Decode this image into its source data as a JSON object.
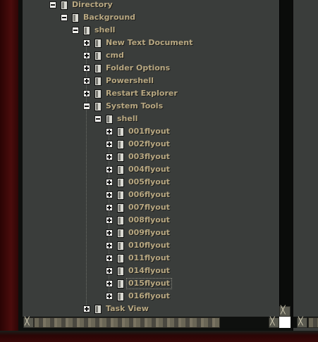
{
  "tree": [
    {
      "label": "Directory",
      "toggle": "minus",
      "level": 0
    },
    {
      "label": "Background",
      "toggle": "minus",
      "level": 1
    },
    {
      "label": "shell",
      "toggle": "minus",
      "level": 2
    },
    {
      "label": "New Text Document",
      "toggle": "plus",
      "level": 3
    },
    {
      "label": "cmd",
      "toggle": "plus",
      "level": 3
    },
    {
      "label": "Folder Options",
      "toggle": "plus",
      "level": 3
    },
    {
      "label": "Powershell",
      "toggle": "plus",
      "level": 3
    },
    {
      "label": "Restart Explorer",
      "toggle": "plus",
      "level": 3
    },
    {
      "label": "System Tools",
      "toggle": "minus",
      "level": 3
    },
    {
      "label": "shell",
      "toggle": "minus",
      "level": 4
    },
    {
      "label": "001flyout",
      "toggle": "plus",
      "level": 5
    },
    {
      "label": "002flyout",
      "toggle": "plus",
      "level": 5
    },
    {
      "label": "003flyout",
      "toggle": "plus",
      "level": 5
    },
    {
      "label": "004flyout",
      "toggle": "plus",
      "level": 5
    },
    {
      "label": "005flyout",
      "toggle": "plus",
      "level": 5
    },
    {
      "label": "006flyout",
      "toggle": "plus",
      "level": 5
    },
    {
      "label": "007flyout",
      "toggle": "plus",
      "level": 5
    },
    {
      "label": "008flyout",
      "toggle": "plus",
      "level": 5
    },
    {
      "label": "009flyout",
      "toggle": "plus",
      "level": 5
    },
    {
      "label": "010flyout",
      "toggle": "plus",
      "level": 5
    },
    {
      "label": "011flyout",
      "toggle": "plus",
      "level": 5
    },
    {
      "label": "014flyout",
      "toggle": "plus",
      "level": 5
    },
    {
      "label": "015flyout",
      "toggle": "plus",
      "level": 5,
      "selected": true
    },
    {
      "label": "016flyout",
      "toggle": "plus",
      "level": 5
    },
    {
      "label": "Task View",
      "toggle": "plus",
      "level": 3
    }
  ],
  "colors": {
    "tree_background": "#3a3d3b",
    "label_text": "#b8a882",
    "desktop_red": "#3a0808",
    "scrollbar_dark": "#0e100e"
  },
  "icons": {
    "expand": "plus-box-icon",
    "collapse": "minus-box-icon",
    "node": "registry-folder-icon",
    "scroll_button": "scroll-arrow-icon"
  }
}
